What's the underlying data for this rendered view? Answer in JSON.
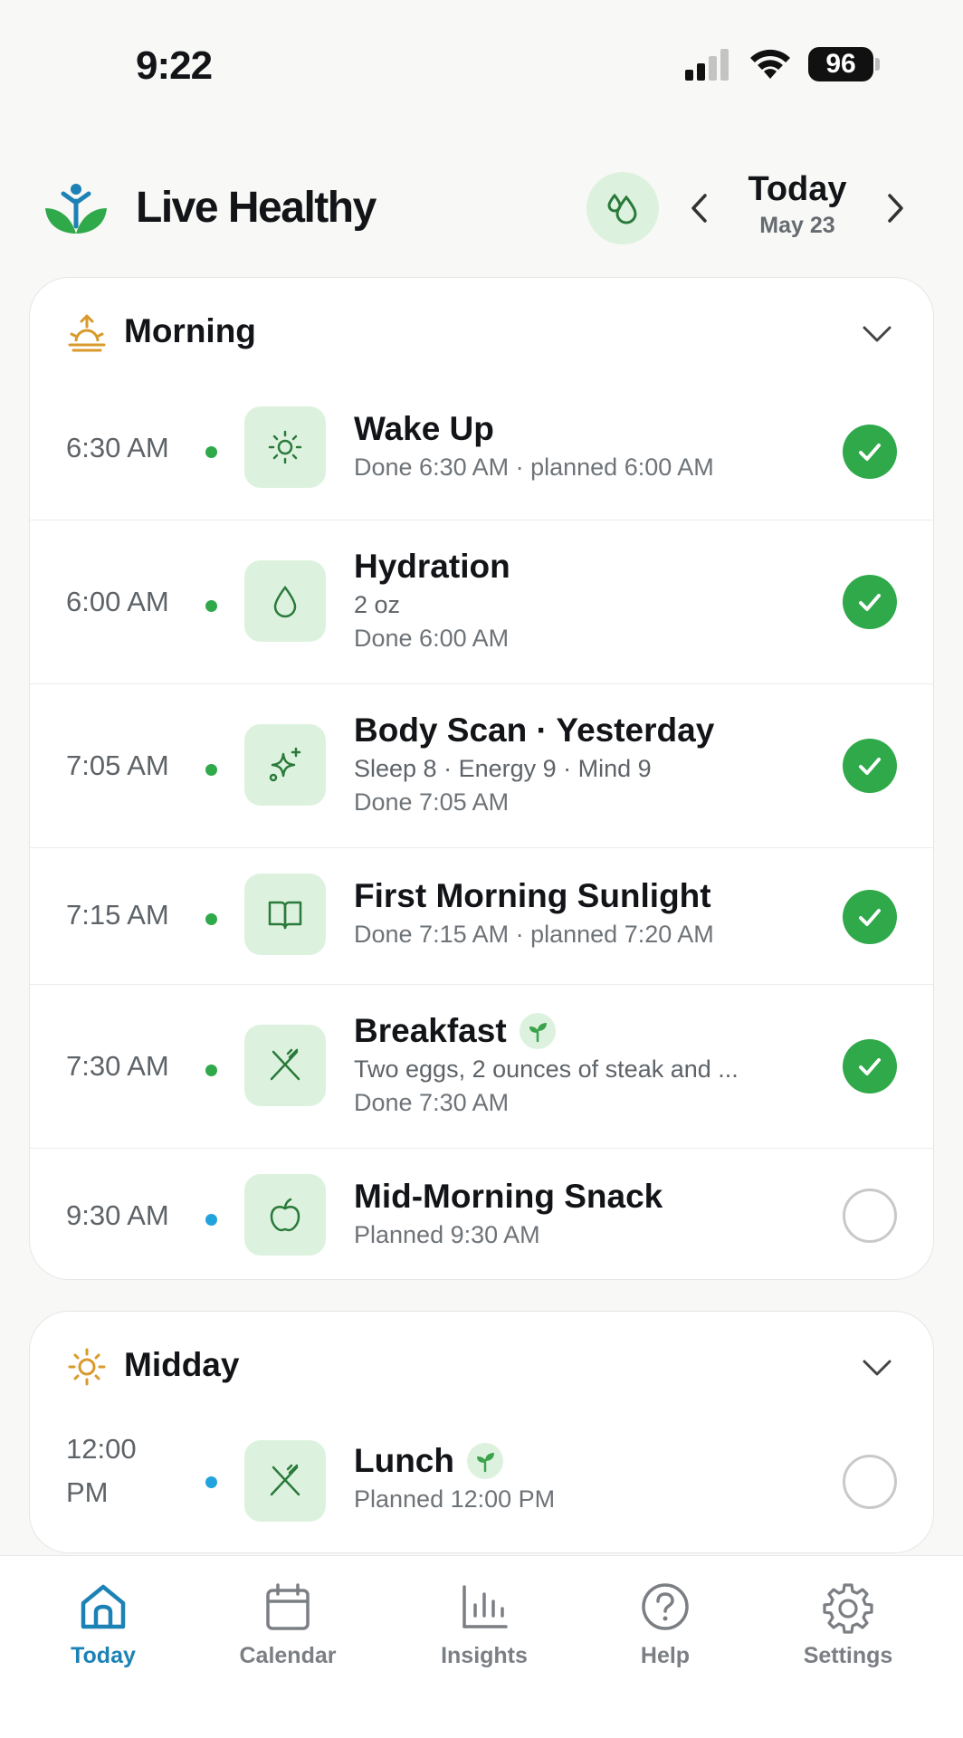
{
  "status_bar": {
    "time": "9:22",
    "battery": "96"
  },
  "header": {
    "app_title": "Live Healthy",
    "date_title": "Today",
    "date_sub": "May 23"
  },
  "sections": {
    "morning": {
      "title": "Morning",
      "items": [
        {
          "time": "6:30 AM",
          "title": "Wake Up",
          "line1": "Done 6:30 AM · planned 6:00 AM",
          "done": true
        },
        {
          "time": "6:00 AM",
          "title": "Hydration",
          "line1": "2 oz",
          "line2": "Done 6:00 AM",
          "done": true
        },
        {
          "time": "7:05 AM",
          "title": "Body Scan · Yesterday",
          "line1": "Sleep 8 · Energy 9 · Mind 9",
          "line2": "Done 7:05 AM",
          "done": true
        },
        {
          "time": "7:15 AM",
          "title": "First Morning Sunlight",
          "line1": "Done 7:15 AM · planned 7:20 AM",
          "done": true
        },
        {
          "time": "7:30 AM",
          "title": "Breakfast",
          "line1": "Two eggs, 2 ounces of steak and ...",
          "line2": "Done 7:30 AM",
          "done": true
        },
        {
          "time": "9:30 AM",
          "title": "Mid-Morning Snack",
          "line1": "Planned 9:30 AM",
          "done": false
        }
      ]
    },
    "midday": {
      "title": "Midday",
      "items": [
        {
          "time_line1": "12:00",
          "time_line2": "PM",
          "title": "Lunch",
          "line1": "Planned 12:00 PM",
          "done": false
        }
      ]
    }
  },
  "tabs": [
    {
      "label": "Today"
    },
    {
      "label": "Calendar"
    },
    {
      "label": "Insights"
    },
    {
      "label": "Help"
    },
    {
      "label": "Settings"
    }
  ],
  "colors": {
    "accent_green": "#2fa94a",
    "tab_active": "#1c82b5",
    "icon_bg": "#ddf2de",
    "planned_dot": "#22a3dc"
  }
}
